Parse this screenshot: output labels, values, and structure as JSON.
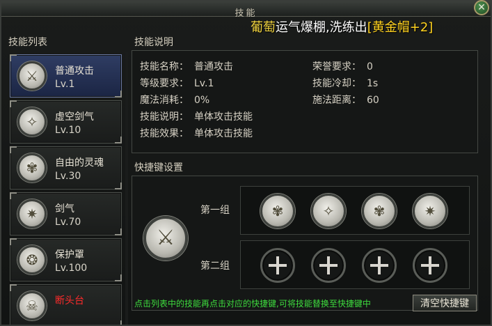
{
  "window": {
    "title": "技能"
  },
  "notice": {
    "name": "葡萄",
    "text": "运气爆棚,洗练出",
    "item": "[黄金帽+2]"
  },
  "sections": {
    "skill_list": "技能列表",
    "skill_desc": "技能说明",
    "hotkey": "快捷键设置"
  },
  "skills": [
    {
      "name": "普通攻击",
      "level": "Lv.1",
      "icon": "sword-icon",
      "glyph": "⚔"
    },
    {
      "name": "虚空剑气",
      "level": "Lv.10",
      "icon": "void-sword-icon",
      "glyph": "✧"
    },
    {
      "name": "自由的灵魂",
      "level": "Lv.30",
      "icon": "soul-icon",
      "glyph": "✾"
    },
    {
      "name": "剑气",
      "level": "Lv.70",
      "icon": "sword-qi-icon",
      "glyph": "✷"
    },
    {
      "name": "保护罩",
      "level": "Lv.100",
      "icon": "shield-icon",
      "glyph": "❂"
    },
    {
      "name": "断头台",
      "level": "",
      "icon": "guillotine-icon",
      "glyph": "☠",
      "color": "#ff2b2b"
    }
  ],
  "description": {
    "name_label": "技能名称：",
    "name_value": "普通攻击",
    "level_label": "等级要求：",
    "level_value": "Lv.1",
    "mana_label": "魔法消耗：",
    "mana_value": "0%",
    "desc_label": "技能说明：",
    "desc_value": "单体攻击技能",
    "effect_label": "技能效果：",
    "effect_value": "单体攻击技能",
    "honor_label": "荣誉要求：",
    "honor_value": "0",
    "cooldown_label": "技能冷却：",
    "cooldown_value": "1s",
    "range_label": "施法距离：",
    "range_value": "60"
  },
  "hotkeys": {
    "group1_label": "第一组",
    "group2_label": "第二组",
    "group1_slots": [
      "soul-icon",
      "void-sword-icon",
      "soul-icon",
      "sword-qi-icon"
    ],
    "group2_slots": [
      "empty",
      "empty",
      "empty",
      "empty"
    ]
  },
  "hint": "点击列表中的技能再点击对应的快捷键,可将技能替换至快捷键中",
  "clear_button": "清空快捷键",
  "colors": {
    "accent_green": "#3edc3e",
    "selected_blue": "#2f3d63",
    "warning_red": "#ff2b2b",
    "notice_gold": "#ffd21f"
  }
}
